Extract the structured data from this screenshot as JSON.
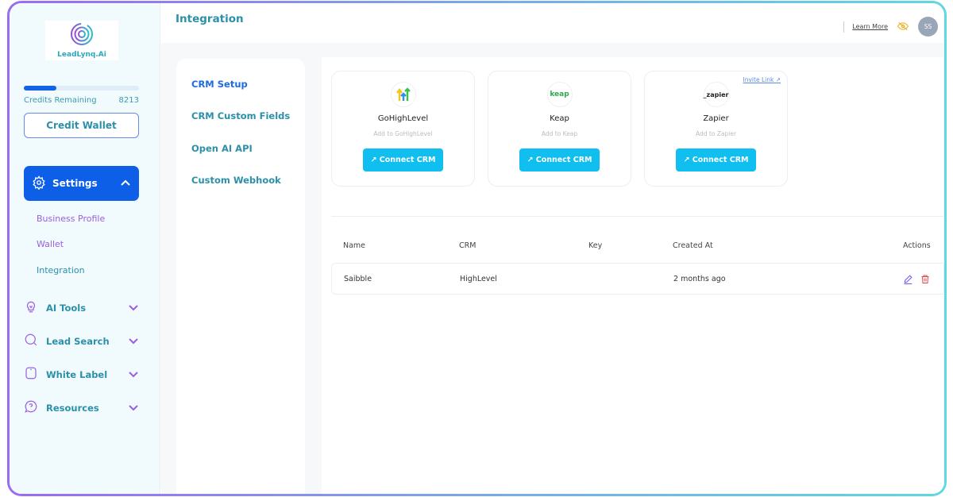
{
  "brand": {
    "name": "LeadLynq.Ai"
  },
  "credits": {
    "label": "Credits Remaining",
    "value": "8213",
    "used_fraction": 0.28
  },
  "sidebar": {
    "wallet_button": "Credit Wallet",
    "settings": {
      "label": "Settings",
      "sub_items": [
        {
          "label": "Business Profile"
        },
        {
          "label": "Wallet"
        },
        {
          "label": "Integration"
        }
      ]
    },
    "items": [
      {
        "label": "AI Tools",
        "icon": "lightbulb-icon"
      },
      {
        "label": "Lead Search",
        "icon": "search-icon"
      },
      {
        "label": "White Label",
        "icon": "tag-icon"
      },
      {
        "label": "Resources",
        "icon": "help-icon"
      }
    ]
  },
  "header": {
    "title": "Integration",
    "learn_more": "Learn More",
    "avatar": "SS"
  },
  "submenu": [
    {
      "label": "CRM Setup"
    },
    {
      "label": "CRM Custom Fields"
    },
    {
      "label": "Open AI API"
    },
    {
      "label": "Custom Webhook"
    }
  ],
  "cards": [
    {
      "name": "GoHighLevel",
      "desc": "Add to GoHighLevel",
      "button": "Connect CRM"
    },
    {
      "name": "Keap",
      "logo": "keap",
      "desc": "Add to Keap",
      "button": "Connect CRM"
    },
    {
      "name": "Zapier",
      "logo": "_zapier",
      "desc": "Add to Zapier",
      "button": "Connect CRM",
      "invite": "Invite Link ↗"
    }
  ],
  "table": {
    "headers": {
      "name": "Name",
      "crm": "CRM",
      "key": "Key",
      "created": "Created At",
      "actions": "Actions"
    },
    "rows": [
      {
        "name": "Saibble",
        "crm": "HighLevel",
        "key": "",
        "created": "2 months ago"
      }
    ]
  },
  "colors": {
    "primary": "#0d5fe8",
    "accent": "#10bff0",
    "teal": "#2b90a8",
    "purple": "#9b6bf0"
  }
}
